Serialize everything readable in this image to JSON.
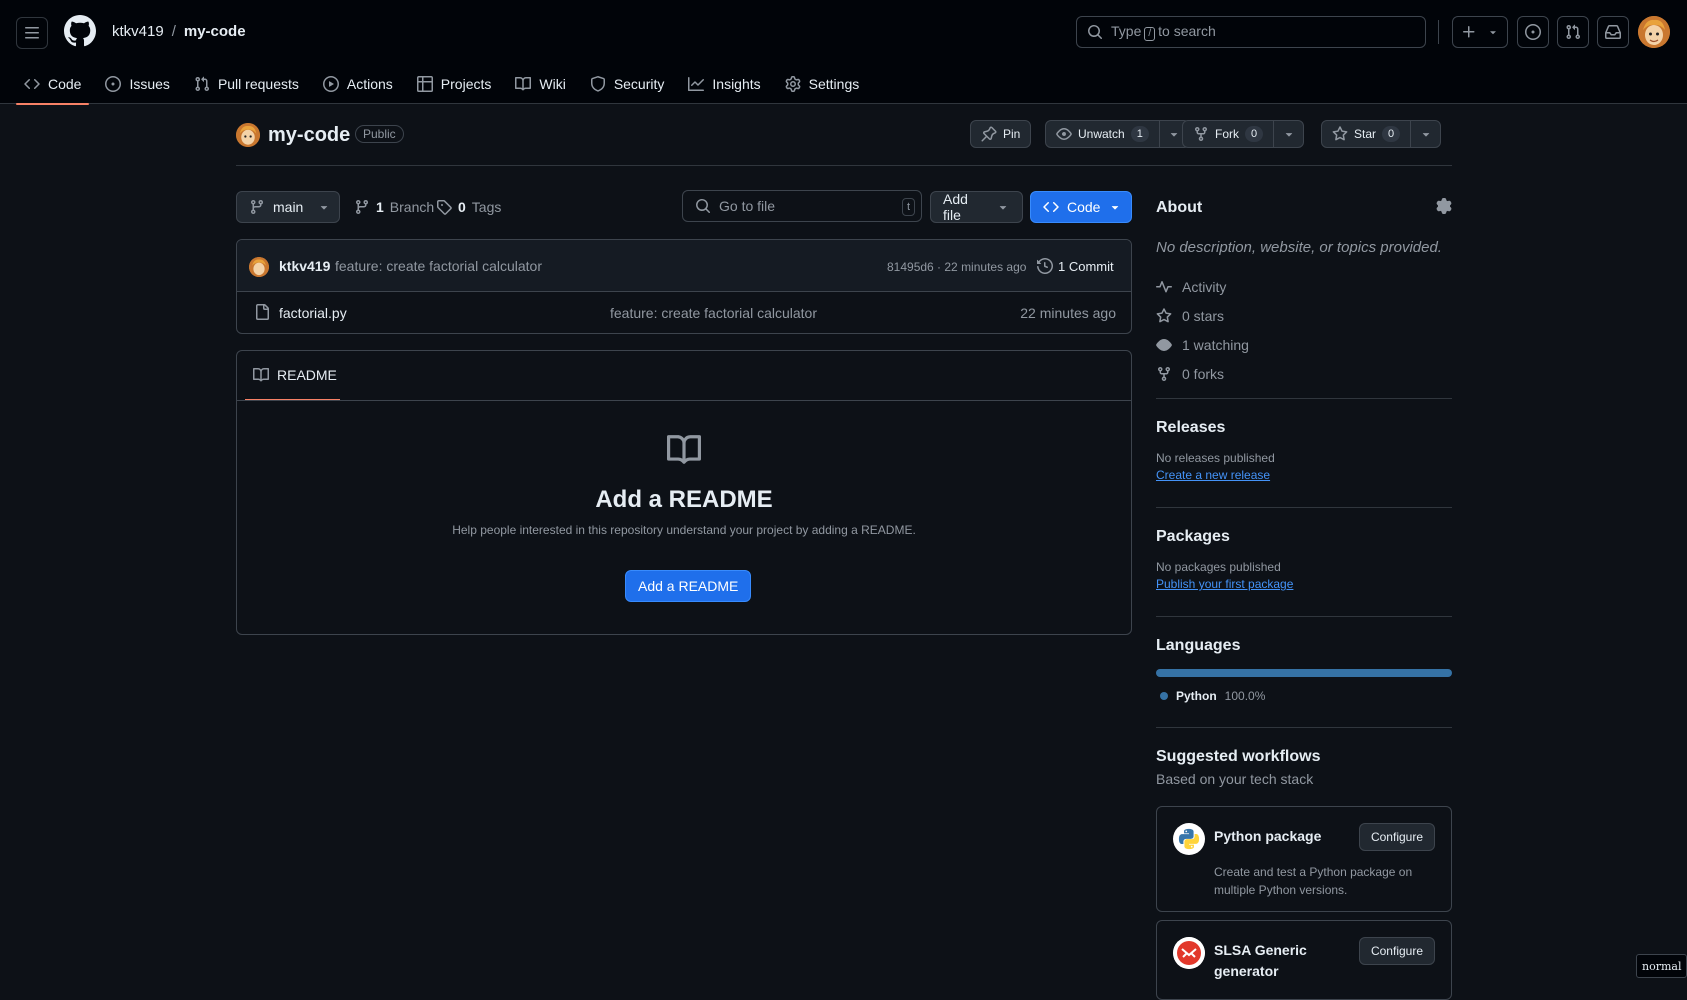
{
  "header": {
    "owner": "ktkv419",
    "separator": "/",
    "repo": "my-code",
    "search_prefix": "Type",
    "search_key": "/",
    "search_suffix": "to search"
  },
  "tabs": [
    {
      "label": "Code",
      "icon": "code-icon"
    },
    {
      "label": "Issues",
      "icon": "issue-icon"
    },
    {
      "label": "Pull requests",
      "icon": "pull-request-icon"
    },
    {
      "label": "Actions",
      "icon": "play-icon"
    },
    {
      "label": "Projects",
      "icon": "table-icon"
    },
    {
      "label": "Wiki",
      "icon": "book-icon"
    },
    {
      "label": "Security",
      "icon": "shield-icon"
    },
    {
      "label": "Insights",
      "icon": "graph-icon"
    },
    {
      "label": "Settings",
      "icon": "gear-icon"
    }
  ],
  "repo_header": {
    "name": "my-code",
    "visibility": "Public",
    "pin": "Pin",
    "unwatch": "Unwatch",
    "watch_count": "1",
    "fork": "Fork",
    "fork_count": "0",
    "star": "Star",
    "star_count": "0"
  },
  "toolbar": {
    "branch": "main",
    "branch_count": "1",
    "branch_label": "Branch",
    "tag_count": "0",
    "tag_label": "Tags",
    "goto_placeholder": "Go to file",
    "goto_key": "t",
    "add_file": "Add file",
    "code": "Code"
  },
  "commit": {
    "user": "ktkv419",
    "message": "feature: create factorial calculator",
    "hash_time": "81495d6 · 22 minutes ago",
    "commits": "1 Commit"
  },
  "files": [
    {
      "name": "factorial.py",
      "message": "feature: create factorial calculator",
      "time": "22 minutes ago"
    }
  ],
  "readme": {
    "tab": "README",
    "title": "Add a README",
    "description": "Help people interested in this repository understand your project by adding a README.",
    "button": "Add a README"
  },
  "sidebar": {
    "about_title": "About",
    "about_desc": "No description, website, or topics provided.",
    "stats": [
      {
        "label": "Activity",
        "icon": "pulse-icon"
      },
      {
        "label": "0 stars",
        "icon": "star-icon"
      },
      {
        "label": "1 watching",
        "icon": "eye-icon"
      },
      {
        "label": "0 forks",
        "icon": "fork-icon"
      }
    ],
    "releases_title": "Releases",
    "releases_text": "No releases published",
    "releases_link": "Create a new release",
    "packages_title": "Packages",
    "packages_text": "No packages published",
    "packages_link": "Publish your first package",
    "languages_title": "Languages",
    "language_name": "Python",
    "language_pct": "100.0%",
    "language_fraction": 1.0,
    "language_color": "#3572A5",
    "workflows_title": "Suggested workflows",
    "workflows_sub": "Based on your tech stack",
    "workflows": [
      {
        "title": "Python package",
        "description": "Create and test a Python package on multiple Python versions.",
        "button": "Configure"
      },
      {
        "title": "SLSA Generic generator",
        "description": "",
        "button": "Configure"
      }
    ]
  },
  "mode_badge": "normal",
  "colors": {
    "accent": "#1f6feb",
    "tab_underline": "#f78166",
    "background": "#0d1117",
    "link": "#4493f8"
  }
}
